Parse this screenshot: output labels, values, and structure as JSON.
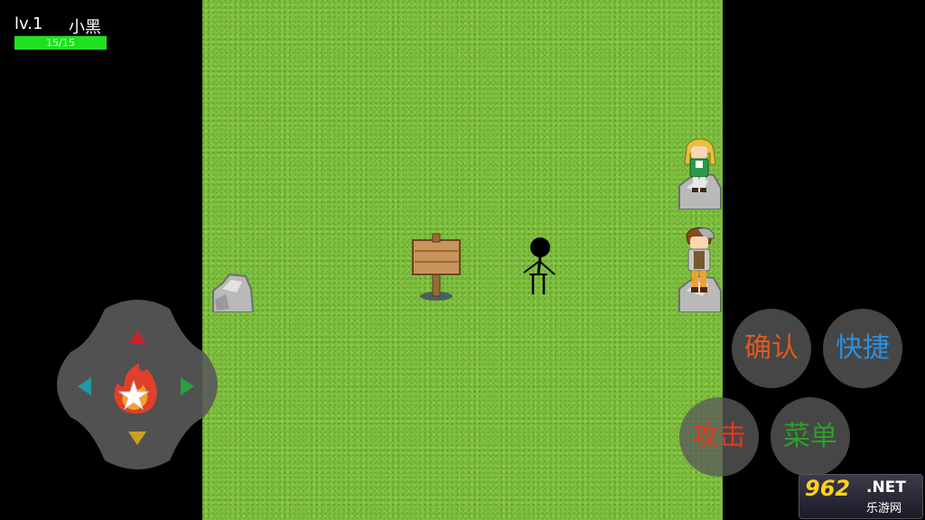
{
  "hud": {
    "level": "lv.1",
    "name": "小黑",
    "hp_text": "15/15",
    "hp_fraction": 1.0
  },
  "controls": {
    "dpad_icons": [
      "up-arrow-icon",
      "down-arrow-icon",
      "left-arrow-icon",
      "right-arrow-icon",
      "flame-star-icon"
    ],
    "confirm": "确认",
    "shortcut": "快捷",
    "attack": "攻击",
    "menu": "菜单"
  },
  "watermark": {
    "number": "962",
    "net": ".NET",
    "subtitle": "乐游网"
  },
  "colors": {
    "grass": "#7fbf3f",
    "hp_bar": "#1fe21f",
    "button_bg": "#5a5a5a",
    "confirm_text": "#e05a20",
    "shortcut_text": "#2a8fe0",
    "attack_text": "#e03a20",
    "menu_text": "#2aa02a"
  }
}
